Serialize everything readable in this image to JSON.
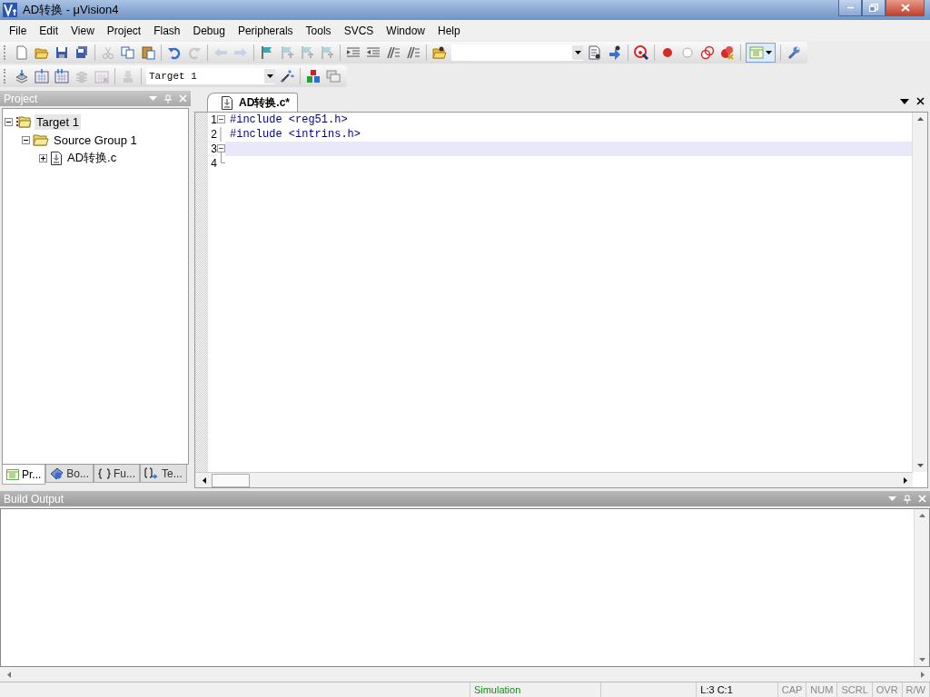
{
  "window": {
    "title": "AD转换 - μVision4"
  },
  "menu": [
    {
      "label": "File"
    },
    {
      "label": "Edit"
    },
    {
      "label": "View"
    },
    {
      "label": "Project"
    },
    {
      "label": "Flash"
    },
    {
      "label": "Debug"
    },
    {
      "label": "Peripherals"
    },
    {
      "label": "Tools"
    },
    {
      "label": "SVCS"
    },
    {
      "label": "Window"
    },
    {
      "label": "Help"
    }
  ],
  "toolbars": [
    {
      "items": [
        {
          "kind": "new",
          "disabled": false
        },
        {
          "kind": "open",
          "disabled": false
        },
        {
          "kind": "save",
          "disabled": false
        },
        {
          "kind": "saveall",
          "disabled": false
        },
        {
          "kind": "separator"
        },
        {
          "kind": "cut",
          "disabled": true
        },
        {
          "kind": "copy",
          "disabled": false
        },
        {
          "kind": "paste",
          "disabled": false
        },
        {
          "kind": "separator"
        },
        {
          "kind": "undo",
          "disabled": false
        },
        {
          "kind": "redo",
          "disabled": true
        },
        {
          "kind": "separator"
        },
        {
          "kind": "back",
          "disabled": true
        },
        {
          "kind": "forward",
          "disabled": true
        },
        {
          "kind": "separator"
        },
        {
          "kind": "bookmark",
          "disabled": false
        },
        {
          "kind": "prevmark",
          "disabled": true
        },
        {
          "kind": "nextmark",
          "disabled": true
        },
        {
          "kind": "clearmarks",
          "disabled": true
        },
        {
          "kind": "separator"
        },
        {
          "kind": "indent",
          "disabled": false
        },
        {
          "kind": "unindent",
          "disabled": false
        },
        {
          "kind": "comment",
          "disabled": false
        },
        {
          "kind": "uncomment",
          "disabled": false
        },
        {
          "kind": "separator"
        },
        {
          "kind": "findfiles",
          "disabled": false
        },
        {
          "kind": "combo"
        },
        {
          "kind": "find",
          "disabled": false
        },
        {
          "kind": "incremental",
          "disabled": false
        },
        {
          "kind": "separator"
        },
        {
          "kind": "debug",
          "disabled": false
        },
        {
          "kind": "separator"
        },
        {
          "kind": "breakpoint",
          "disabled": false
        },
        {
          "kind": "bpdisable",
          "disabled": false
        },
        {
          "kind": "bpdisableall",
          "disabled": false
        },
        {
          "kind": "bpkill",
          "disabled": false
        },
        {
          "kind": "separator"
        },
        {
          "kind": "windows",
          "disabled": false
        },
        {
          "kind": "separator"
        },
        {
          "kind": "wrench",
          "disabled": false
        }
      ]
    },
    {
      "items": [
        {
          "kind": "translate",
          "disabled": false
        },
        {
          "kind": "build",
          "disabled": false
        },
        {
          "kind": "rebuild",
          "disabled": false
        },
        {
          "kind": "batch",
          "disabled": true
        },
        {
          "kind": "stop",
          "disabled": true
        },
        {
          "kind": "separator"
        },
        {
          "kind": "download",
          "disabled": true
        },
        {
          "kind": "separator"
        },
        {
          "kind": "combo",
          "value": "Target 1"
        },
        {
          "kind": "options",
          "disabled": false
        },
        {
          "kind": "separator"
        },
        {
          "kind": "manage",
          "disabled": false
        },
        {
          "kind": "select",
          "disabled": false
        }
      ]
    }
  ],
  "project_pane": {
    "title": "Project",
    "tree": [
      {
        "label": "Target 1",
        "kind": "target",
        "expanded": true,
        "selected": true,
        "children": [
          {
            "label": "Source Group 1",
            "kind": "group",
            "expanded": true,
            "selected": false,
            "children": [
              {
                "label": "AD转换.c",
                "kind": "file",
                "expanded": false,
                "selected": false
              }
            ]
          }
        ]
      }
    ],
    "tabs": [
      {
        "label": "Pr...",
        "kind": "project",
        "selected": true
      },
      {
        "label": "Bo...",
        "kind": "books",
        "selected": false
      },
      {
        "label": "Fu...",
        "kind": "functions",
        "selected": false
      },
      {
        "label": "Te...",
        "kind": "templates",
        "selected": false
      }
    ]
  },
  "editor": {
    "tabs": [
      {
        "label": "AD转换.c*",
        "selected": true
      }
    ],
    "lines": [
      {
        "number": "1",
        "text": "#include <reg51.h>",
        "kind": "start",
        "current": false
      },
      {
        "number": "2",
        "text": "#include <intrins.h>",
        "kind": "line",
        "current": false
      },
      {
        "number": "3",
        "kind": "start",
        "current": true
      },
      {
        "number": "4",
        "kind": "end",
        "current": false
      }
    ]
  },
  "build_output": {
    "title": "Build Output"
  },
  "status_bar": {
    "mode": "Simulation",
    "position": "L:3 C:1",
    "indicators": [
      {
        "label": "CAP",
        "on": false
      },
      {
        "label": "NUM",
        "on": false
      },
      {
        "label": "SCRL",
        "on": false
      },
      {
        "label": "OVR",
        "on": false
      },
      {
        "label": "R/W",
        "on": false
      }
    ]
  }
}
